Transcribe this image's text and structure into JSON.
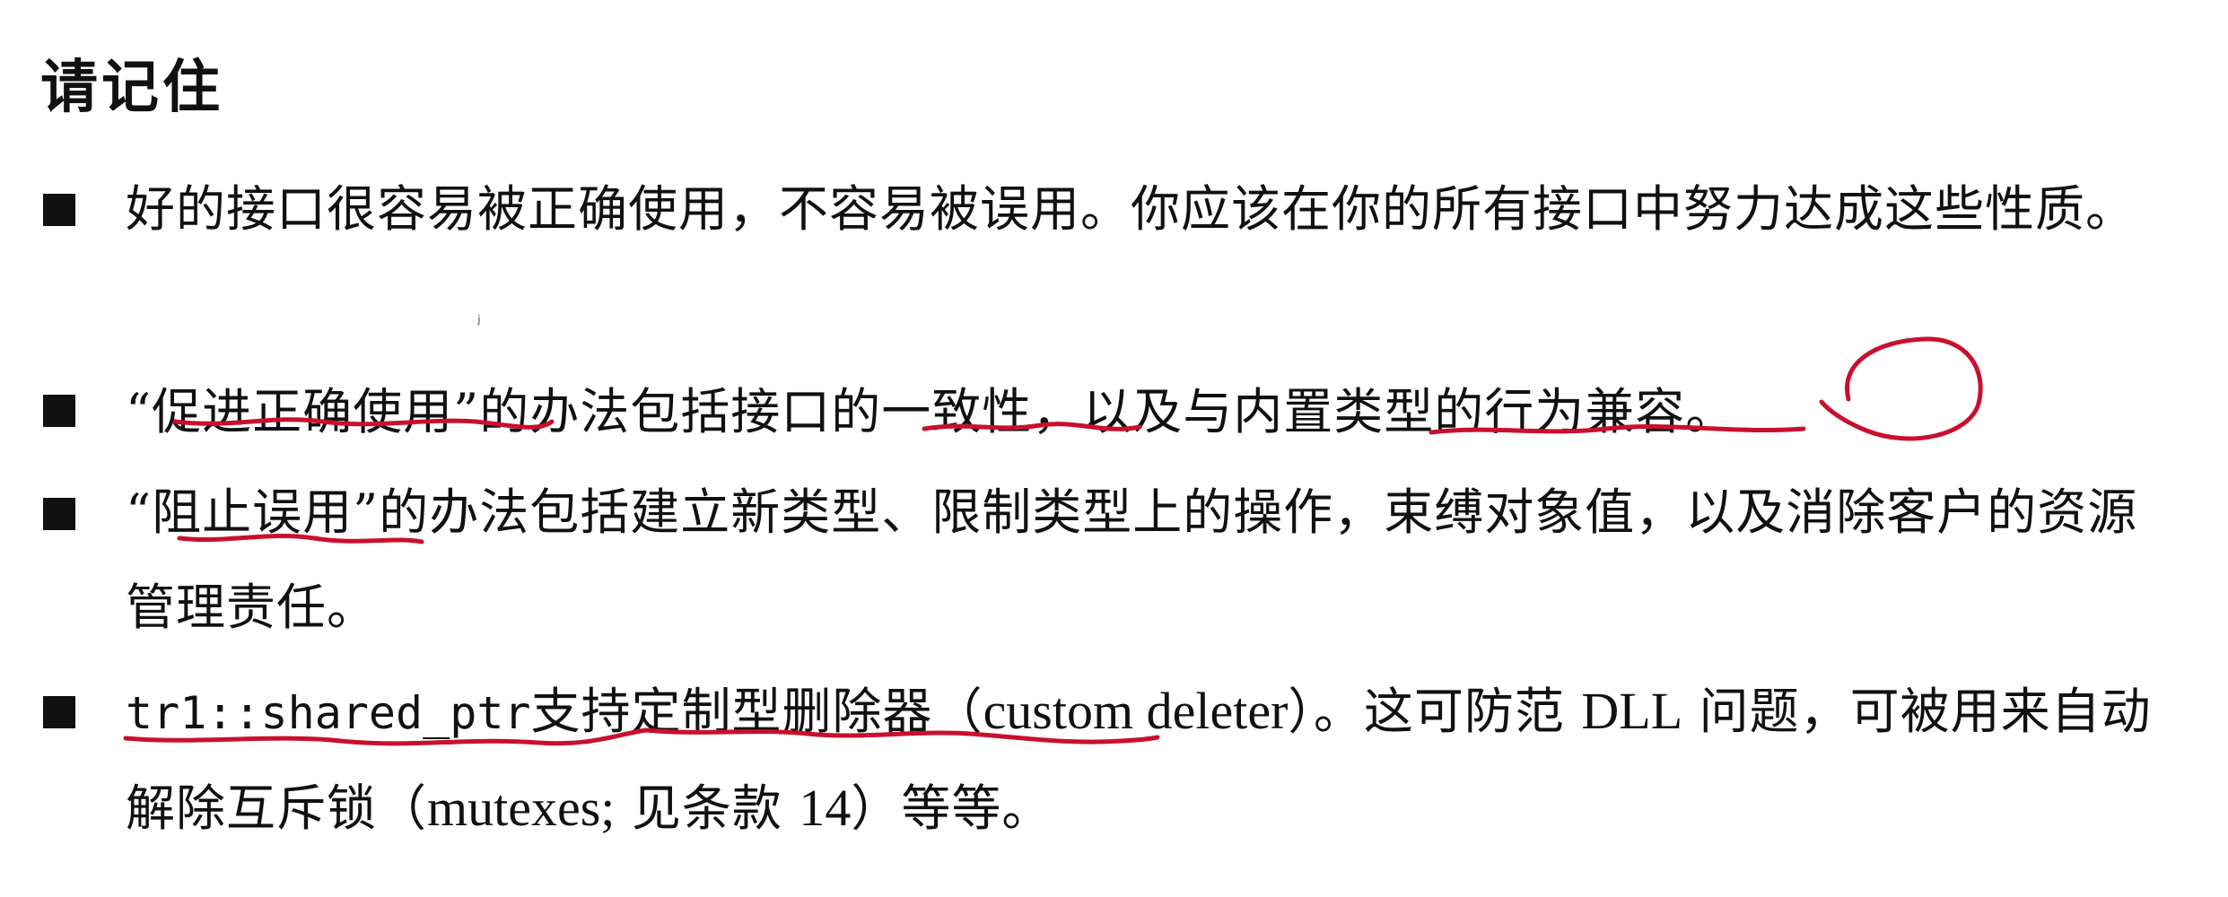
{
  "heading": "请记住",
  "bullets": [
    {
      "text": "好的接口很容易被正确使用，不容易被误用。你应该在你的所有接口中努力达成这些性质。"
    },
    {
      "text": "“促进正确使用”的办法包括接口的一致性，以及与内置类型的行为兼容。"
    },
    {
      "text": "“阻止误用”的办法包括建立新类型、限制类型上的操作，束缚对象值，以及消除客户的资源管理责任。"
    },
    {
      "code": "tr1::shared_ptr",
      "text_a": "支持定制型删除器（",
      "latin_a": "custom deleter",
      "text_b": "）。这可防范",
      "latin_b": "DLL",
      "text_c": "问题，可被用来自动解除互斥锁（",
      "latin_c": "mutexes;",
      "text_d": "见条款",
      "latin_d": "14",
      "text_e": "）等等。"
    }
  ],
  "annotation_color": "#c8102e",
  "text_color": "#111111"
}
